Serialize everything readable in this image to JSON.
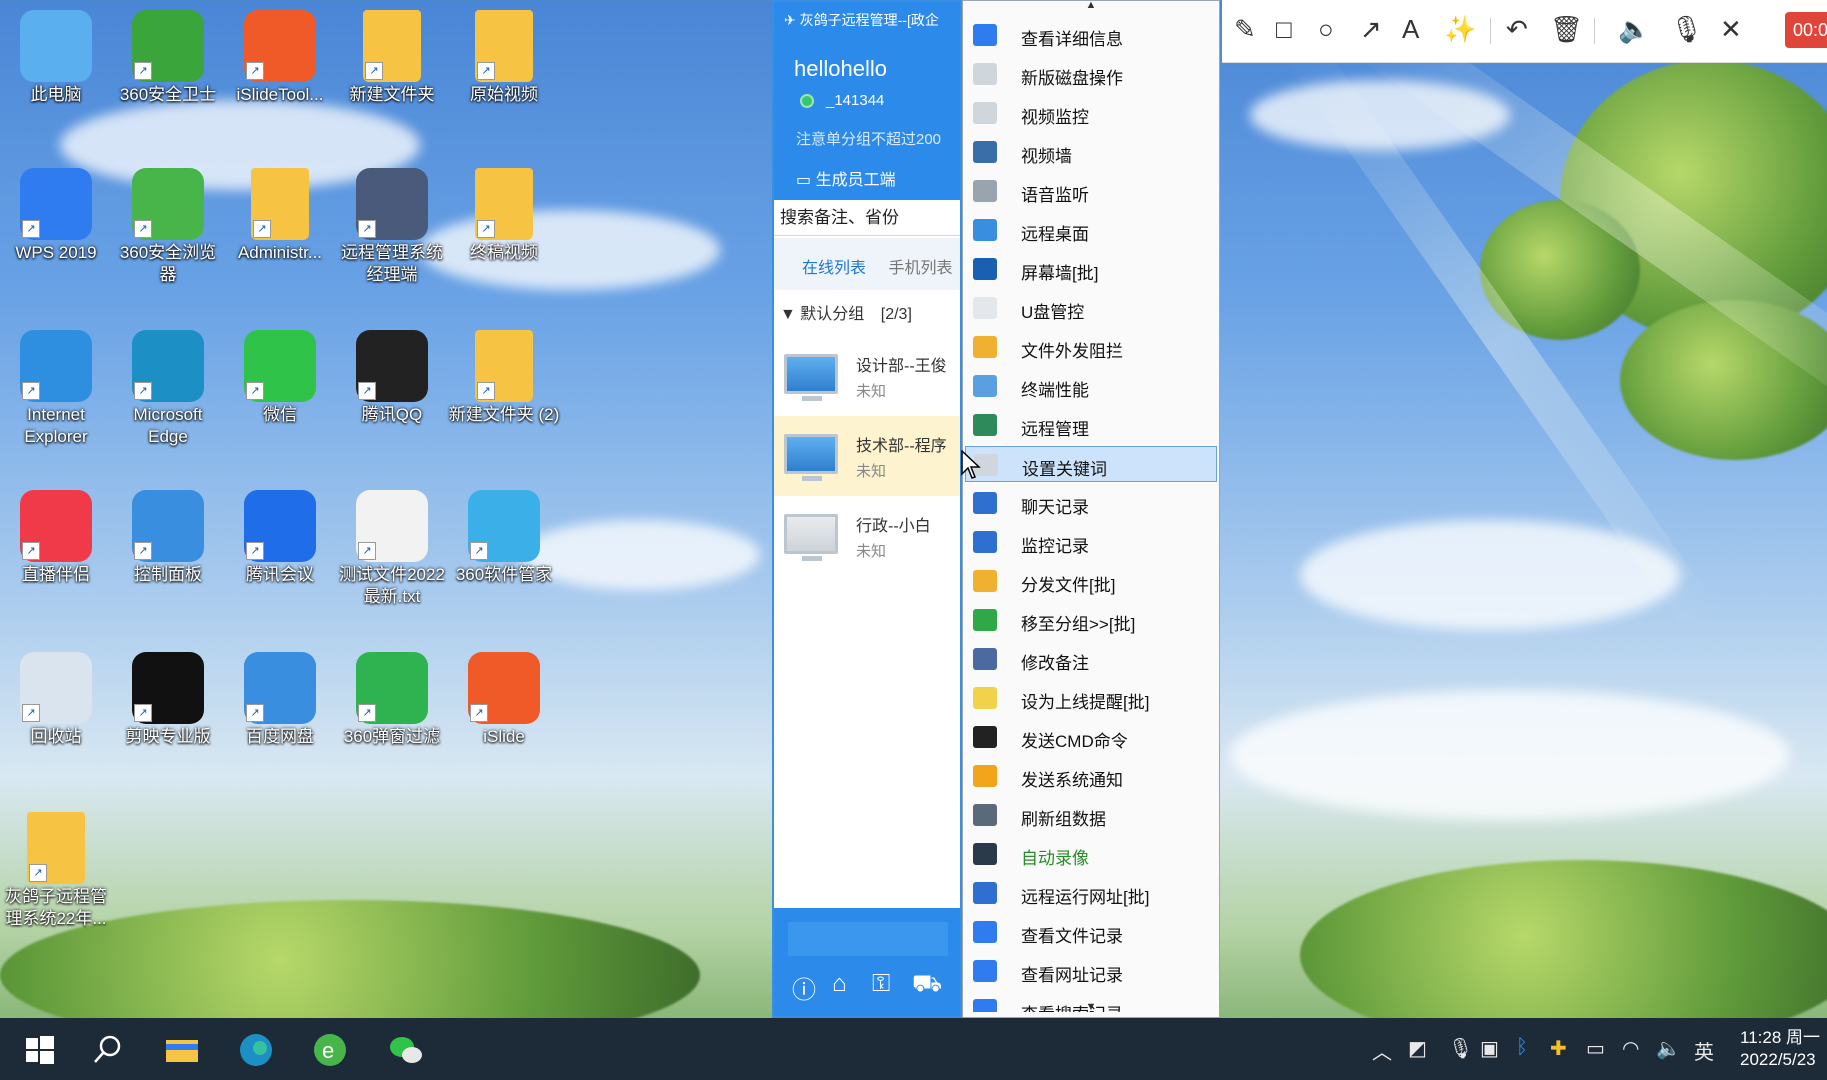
{
  "desktop": {
    "icons": [
      {
        "label": "此电脑",
        "icon": "computer-icon",
        "color": "#5ab0ef"
      },
      {
        "label": "360安全卫士",
        "icon": "360-security-icon",
        "color": "#3aa53a"
      },
      {
        "label": "iSlideTool...",
        "icon": "islide-icon",
        "color": "#f05a28"
      },
      {
        "label": "新建文件夹",
        "icon": "folder-icon",
        "color": "#f6c342"
      },
      {
        "label": "原始视频",
        "icon": "folder-icon",
        "color": "#f6c342"
      },
      {
        "label": "WPS 2019",
        "icon": "wps-icon",
        "color": "#2f7cf0"
      },
      {
        "label": "360安全浏览器",
        "icon": "360-browser-icon",
        "color": "#48b54a"
      },
      {
        "label": "Administr...",
        "icon": "user-folder-icon",
        "color": "#f6c342"
      },
      {
        "label": "远程管理系统经理端",
        "icon": "remote-manager-icon",
        "color": "#4a5a7a"
      },
      {
        "label": "终稿视频",
        "icon": "folder-icon",
        "color": "#f6c342"
      },
      {
        "label": "Internet Explorer",
        "icon": "ie-icon",
        "color": "#2e8fe0"
      },
      {
        "label": "Microsoft Edge",
        "icon": "edge-icon",
        "color": "#1c8fc4"
      },
      {
        "label": "微信",
        "icon": "wechat-icon",
        "color": "#2fc34a"
      },
      {
        "label": "腾讯QQ",
        "icon": "qq-icon",
        "color": "#222222"
      },
      {
        "label": "新建文件夹 (2)",
        "icon": "folder-icon",
        "color": "#f6c342"
      },
      {
        "label": "直播伴侣",
        "icon": "live-icon",
        "color": "#f03a4a"
      },
      {
        "label": "控制面板",
        "icon": "control-panel-icon",
        "color": "#3a8ee0"
      },
      {
        "label": "腾讯会议",
        "icon": "tencent-meeting-icon",
        "color": "#1f6de8"
      },
      {
        "label": "测试文件2022最新.txt",
        "icon": "text-file-icon",
        "color": "#f2f2f2"
      },
      {
        "label": "360软件管家",
        "icon": "360-software-icon",
        "color": "#3bb0e8"
      },
      {
        "label": "回收站",
        "icon": "recycle-bin-icon",
        "color": "#d9e4ee"
      },
      {
        "label": "剪映专业版",
        "icon": "capcut-icon",
        "color": "#111111"
      },
      {
        "label": "百度网盘",
        "icon": "baidu-netdisk-icon",
        "color": "#3a8ee0"
      },
      {
        "label": "360弹窗过滤",
        "icon": "popup-filter-icon",
        "color": "#2fb350"
      },
      {
        "label": "iSlide",
        "icon": "islide-icon",
        "color": "#f05a28"
      },
      {
        "label": "灰鸽子远程管理系统22年...",
        "icon": "zip-icon",
        "color": "#f6c342"
      }
    ]
  },
  "client": {
    "title": "灰鸽子远程管理--[政企",
    "username": "hellohello",
    "user_id": "_141344",
    "notice": "注意单分组不超过200",
    "generate_button": "生成员工端",
    "search_placeholder": "搜索备注、省份",
    "tabs": [
      "在线列表",
      "手机列表"
    ],
    "group": "默认分组",
    "group_count": "[2/3]",
    "devices": [
      {
        "name": "设计部--王俊",
        "status": "未知"
      },
      {
        "name": "技术部--程序",
        "status": "未知"
      },
      {
        "name": "行政--小白",
        "status": "未知"
      }
    ]
  },
  "menu": {
    "items": [
      {
        "label": "查看详细信息",
        "icon": "info-icon",
        "color": "#2f7cf0"
      },
      {
        "label": "新版磁盘操作",
        "icon": "disk-icon",
        "color": "#cfd6dc"
      },
      {
        "label": "视频监控",
        "icon": "camera-icon",
        "color": "#cfd6dc"
      },
      {
        "label": "视频墙",
        "icon": "video-wall-icon",
        "color": "#3a6ea8"
      },
      {
        "label": "语音监听",
        "icon": "microphone-icon",
        "color": "#9aa4ae"
      },
      {
        "label": "远程桌面",
        "icon": "desktop-icon",
        "color": "#3a8ee0"
      },
      {
        "label": "屏幕墙[批]",
        "icon": "screen-wall-icon",
        "color": "#1b5fb0"
      },
      {
        "label": "U盘管控",
        "icon": "usb-icon",
        "color": "#e4e8ec"
      },
      {
        "label": "文件外发阻拦",
        "icon": "folder-block-icon",
        "color": "#f0b030"
      },
      {
        "label": "终端性能",
        "icon": "performance-icon",
        "color": "#5aa0e0"
      },
      {
        "label": "远程管理",
        "icon": "remote-manage-icon",
        "color": "#2e8a5a"
      },
      {
        "label": "设置关键词",
        "icon": "keyword-icon",
        "color": "#cfd6dc"
      },
      {
        "label": "聊天记录",
        "icon": "chat-record-icon",
        "color": "#2f6fd0"
      },
      {
        "label": "监控记录",
        "icon": "monitor-record-icon",
        "color": "#2f6fd0"
      },
      {
        "label": "分发文件[批]",
        "icon": "folder-send-icon",
        "color": "#f0b030"
      },
      {
        "label": "移至分组>>[批]",
        "icon": "move-group-icon",
        "color": "#2fa84a"
      },
      {
        "label": "修改备注",
        "icon": "edit-note-icon",
        "color": "#4a6aa0"
      },
      {
        "label": "设为上线提醒[批]",
        "icon": "lightbulb-icon",
        "color": "#f2d24a"
      },
      {
        "label": "发送CMD命令",
        "icon": "cmd-icon",
        "color": "#222222"
      },
      {
        "label": "发送系统通知",
        "icon": "warning-icon",
        "color": "#f2a51a"
      },
      {
        "label": "刷新组数据",
        "icon": "refresh-icon",
        "color": "#5a6a7a"
      },
      {
        "label": "自动录像",
        "icon": "record-icon",
        "color": "#2a3a4a"
      },
      {
        "label": "远程运行网址[批]",
        "icon": "globe-icon",
        "color": "#2f6fd0"
      },
      {
        "label": "查看文件记录",
        "icon": "magnifier-icon",
        "color": "#2f7cf0"
      },
      {
        "label": "查看网址记录",
        "icon": "magnifier-icon",
        "color": "#2f7cf0"
      },
      {
        "label": "查看搜索记录",
        "icon": "magnifier-icon",
        "color": "#2f7cf0"
      }
    ],
    "highlighted": "设置关键词",
    "green_item": "自动录像"
  },
  "recorder": {
    "tools": [
      "pencil-icon",
      "rectangle-icon",
      "circle-icon",
      "arrow-icon",
      "text-icon",
      "magic-wand-icon",
      "undo-icon",
      "trash-icon",
      "speaker-icon",
      "microphone-icon",
      "close-icon"
    ],
    "time": "00:0"
  },
  "taskbar": {
    "clock_time": "11:28 周一",
    "clock_date": "2022/5/23",
    "ime": "英"
  }
}
